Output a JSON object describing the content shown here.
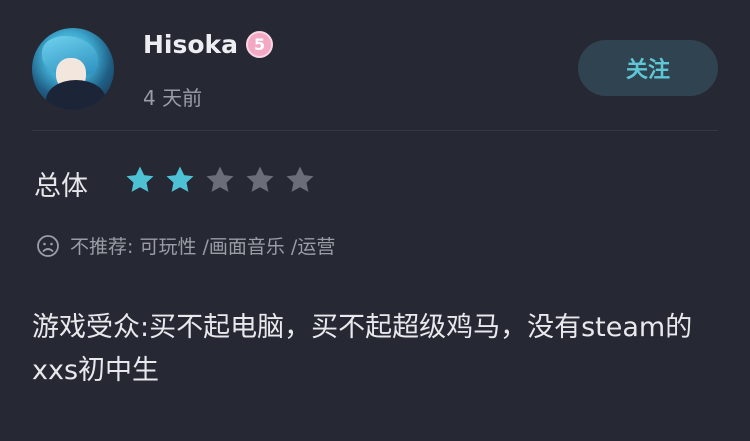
{
  "user": {
    "name": "Hisoka",
    "level": "5",
    "time": "4 天前"
  },
  "follow_label": "关注",
  "rating": {
    "label": "总体",
    "stars": 2,
    "max_stars": 5,
    "filled_color": "#4fc1d5",
    "empty_color": "#6b6d78"
  },
  "recommendation": {
    "icon": "sad-face-icon",
    "text": "不推荐: 可玩性 /画面音乐 /运营"
  },
  "review": {
    "text": "游戏受众:买不起电脑，买不起超级鸡马，没有steam的xxs初中生"
  },
  "colors": {
    "background": "#262833",
    "accent": "#5fc6d6",
    "level_badge": "#f3a9c4"
  }
}
